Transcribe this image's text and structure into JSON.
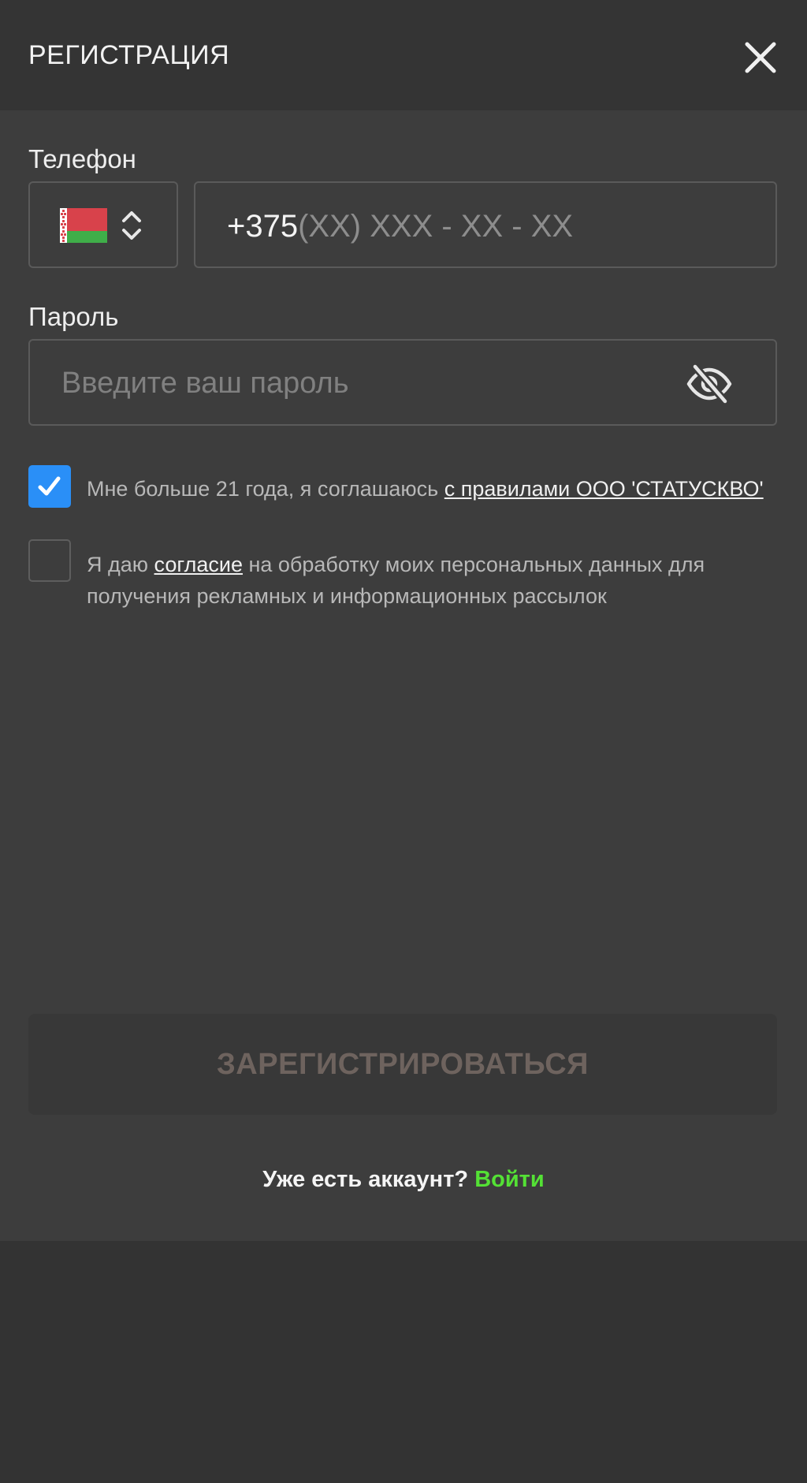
{
  "header": {
    "title": "РЕГИСТРАЦИЯ",
    "close_icon": "close-icon"
  },
  "phone": {
    "label": "Телефон",
    "country_flag": "belarus-flag-icon",
    "country_selector_icon": "chevron-up-down-icon",
    "prefix": "+375",
    "mask_placeholder": "(XX) XXX - XX - XX"
  },
  "password": {
    "label": "Пароль",
    "value": "",
    "placeholder": "Введите ваш пароль",
    "visibility_icon": "eye-off-icon"
  },
  "agreements": [
    {
      "checked": true,
      "text_before": "Мне больше 21 года, я соглашаюсь ",
      "link_text": "с правилами ООО 'СТАТУСКВО'",
      "text_after": ""
    },
    {
      "checked": false,
      "text_before": "Я даю ",
      "link_text": "согласие",
      "text_after": " на обработку моих персональных данных для получения рекламных и информационных рассылок"
    }
  ],
  "register_button": {
    "label": "ЗАРЕГИСТРИРОВАТЬСЯ",
    "disabled": true
  },
  "login": {
    "question": "Уже есть аккаунт?",
    "link": "Войти"
  },
  "colors": {
    "background": "#333333",
    "panel": "#3d3d3d",
    "checkbox_accent": "#2a8ff7",
    "login_link": "#54e135",
    "button_disabled_text": "#6e635e"
  }
}
